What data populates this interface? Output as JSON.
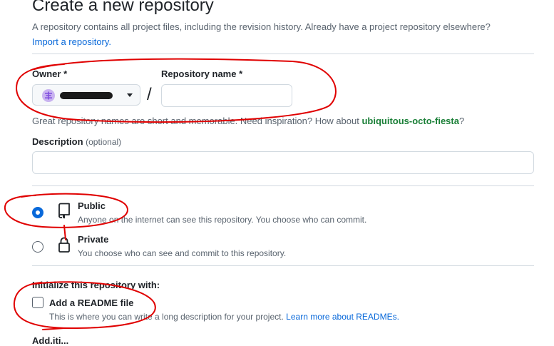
{
  "page": {
    "title": "Create a new repository",
    "subtitle": "A repository contains all project files, including the revision history. Already have a project repository elsewhere?",
    "import_link": "Import a repository."
  },
  "owner": {
    "label": "Owner *",
    "avatar_icon": "octo-avatar-icon",
    "caret_icon": "triangle-down-icon"
  },
  "repo_name": {
    "label": "Repository name *",
    "separator": "/",
    "value": "",
    "placeholder": ""
  },
  "hint": {
    "text": "Great repository names are short and memorable. Need inspiration? How about",
    "suggestion": "ubiquitous-octo-fiesta",
    "suffix": "?"
  },
  "description": {
    "label": "Description",
    "optional": "(optional)",
    "value": ""
  },
  "visibility": {
    "options": [
      {
        "title": "Public",
        "description": "Anyone on the internet can see this repository. You choose who can commit.",
        "icon": "repo-icon",
        "selected": true
      },
      {
        "title": "Private",
        "description": "You choose who can see and commit to this repository.",
        "icon": "lock-icon",
        "selected": false
      }
    ]
  },
  "initialize": {
    "label": "Initialize this repository with:",
    "readme_title": "Add a README file",
    "readme_desc": "This is where you can write a long description for your project.",
    "readme_link": "Learn more about READMEs.",
    "readme_checked": false,
    "next_section_partial": "Add.iti..."
  },
  "colors": {
    "accent": "#0969da",
    "suggestion": "#1a7f37",
    "annotation": "#e00000"
  }
}
